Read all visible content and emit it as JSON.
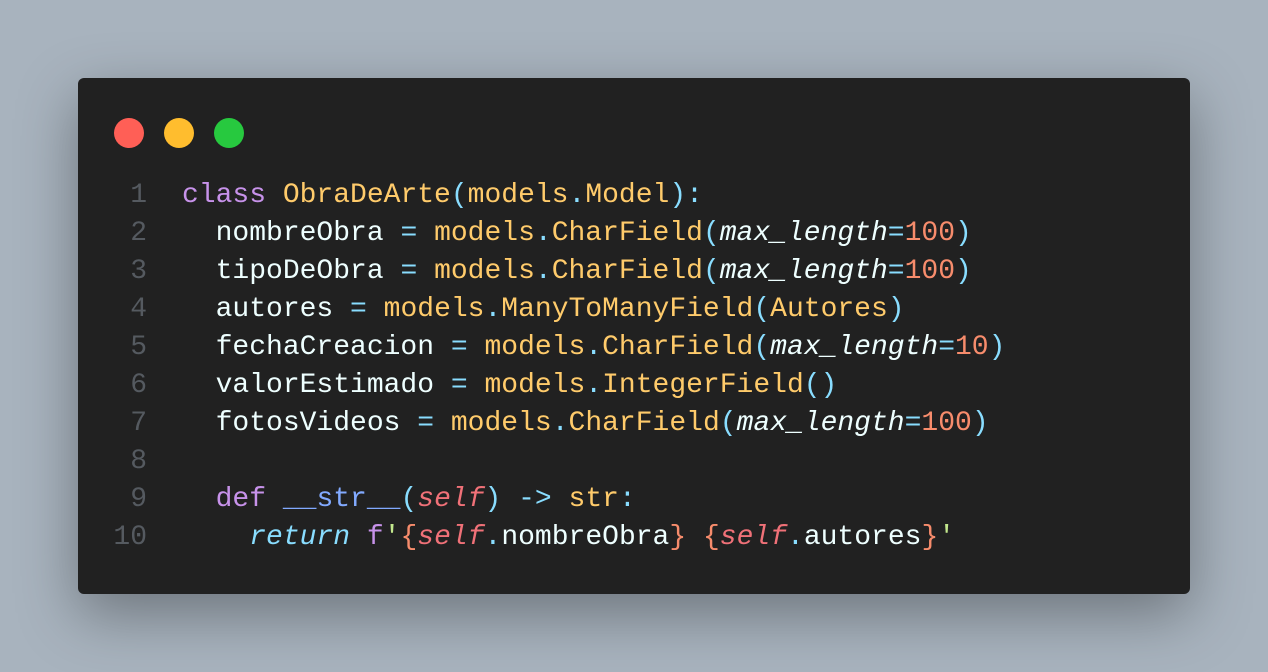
{
  "window": {
    "controls": [
      "close",
      "minimize",
      "maximize"
    ],
    "colors": {
      "background": "#212121",
      "close": "#ff5f56",
      "minimize": "#ffbd2e",
      "maximize": "#27c93f"
    }
  },
  "code": {
    "language": "python",
    "lines": [
      {
        "number": "1",
        "tokens": [
          {
            "t": "class",
            "c": "kw"
          },
          {
            "t": " ",
            "c": ""
          },
          {
            "t": "ObraDeArte",
            "c": "cls"
          },
          {
            "t": "(",
            "c": "punc"
          },
          {
            "t": "models",
            "c": "cls"
          },
          {
            "t": ".",
            "c": "punc"
          },
          {
            "t": "Model",
            "c": "cls"
          },
          {
            "t": "):",
            "c": "punc"
          }
        ]
      },
      {
        "number": "2",
        "tokens": [
          {
            "t": "  nombreObra ",
            "c": ""
          },
          {
            "t": "=",
            "c": "punc"
          },
          {
            "t": " ",
            "c": ""
          },
          {
            "t": "models",
            "c": "cls"
          },
          {
            "t": ".",
            "c": "punc"
          },
          {
            "t": "CharField",
            "c": "cls"
          },
          {
            "t": "(",
            "c": "punc"
          },
          {
            "t": "max_length",
            "c": "param"
          },
          {
            "t": "=",
            "c": "punc"
          },
          {
            "t": "100",
            "c": "num"
          },
          {
            "t": ")",
            "c": "punc"
          }
        ]
      },
      {
        "number": "3",
        "tokens": [
          {
            "t": "  tipoDeObra ",
            "c": ""
          },
          {
            "t": "=",
            "c": "punc"
          },
          {
            "t": " ",
            "c": ""
          },
          {
            "t": "models",
            "c": "cls"
          },
          {
            "t": ".",
            "c": "punc"
          },
          {
            "t": "CharField",
            "c": "cls"
          },
          {
            "t": "(",
            "c": "punc"
          },
          {
            "t": "max_length",
            "c": "param"
          },
          {
            "t": "=",
            "c": "punc"
          },
          {
            "t": "100",
            "c": "num"
          },
          {
            "t": ")",
            "c": "punc"
          }
        ]
      },
      {
        "number": "4",
        "tokens": [
          {
            "t": "  autores ",
            "c": ""
          },
          {
            "t": "=",
            "c": "punc"
          },
          {
            "t": " ",
            "c": ""
          },
          {
            "t": "models",
            "c": "cls"
          },
          {
            "t": ".",
            "c": "punc"
          },
          {
            "t": "ManyToManyField",
            "c": "cls"
          },
          {
            "t": "(",
            "c": "punc"
          },
          {
            "t": "Autores",
            "c": "cls"
          },
          {
            "t": ")",
            "c": "punc"
          }
        ]
      },
      {
        "number": "5",
        "tokens": [
          {
            "t": "  fechaCreacion ",
            "c": ""
          },
          {
            "t": "=",
            "c": "punc"
          },
          {
            "t": " ",
            "c": ""
          },
          {
            "t": "models",
            "c": "cls"
          },
          {
            "t": ".",
            "c": "punc"
          },
          {
            "t": "CharField",
            "c": "cls"
          },
          {
            "t": "(",
            "c": "punc"
          },
          {
            "t": "max_length",
            "c": "param"
          },
          {
            "t": "=",
            "c": "punc"
          },
          {
            "t": "10",
            "c": "num"
          },
          {
            "t": ")",
            "c": "punc"
          }
        ]
      },
      {
        "number": "6",
        "tokens": [
          {
            "t": "  valorEstimado ",
            "c": ""
          },
          {
            "t": "=",
            "c": "punc"
          },
          {
            "t": " ",
            "c": ""
          },
          {
            "t": "models",
            "c": "cls"
          },
          {
            "t": ".",
            "c": "punc"
          },
          {
            "t": "IntegerField",
            "c": "cls"
          },
          {
            "t": "()",
            "c": "punc"
          }
        ]
      },
      {
        "number": "7",
        "tokens": [
          {
            "t": "  fotosVideos ",
            "c": ""
          },
          {
            "t": "=",
            "c": "punc"
          },
          {
            "t": " ",
            "c": ""
          },
          {
            "t": "models",
            "c": "cls"
          },
          {
            "t": ".",
            "c": "punc"
          },
          {
            "t": "CharField",
            "c": "cls"
          },
          {
            "t": "(",
            "c": "punc"
          },
          {
            "t": "max_length",
            "c": "param"
          },
          {
            "t": "=",
            "c": "punc"
          },
          {
            "t": "100",
            "c": "num"
          },
          {
            "t": ")",
            "c": "punc"
          }
        ]
      },
      {
        "number": "8",
        "tokens": []
      },
      {
        "number": "9",
        "tokens": [
          {
            "t": "  ",
            "c": ""
          },
          {
            "t": "def",
            "c": "kw"
          },
          {
            "t": " ",
            "c": ""
          },
          {
            "t": "__str__",
            "c": "fn"
          },
          {
            "t": "(",
            "c": "punc"
          },
          {
            "t": "self",
            "c": "self"
          },
          {
            "t": ")",
            "c": "punc"
          },
          {
            "t": " ",
            "c": ""
          },
          {
            "t": "->",
            "c": "punc"
          },
          {
            "t": " ",
            "c": ""
          },
          {
            "t": "str",
            "c": "cls"
          },
          {
            "t": ":",
            "c": "punc"
          }
        ]
      },
      {
        "number": "10",
        "tokens": [
          {
            "t": "    ",
            "c": ""
          },
          {
            "t": "return",
            "c": "ret"
          },
          {
            "t": " ",
            "c": ""
          },
          {
            "t": "f",
            "c": "kw"
          },
          {
            "t": "'",
            "c": "str"
          },
          {
            "t": "{",
            "c": "brace"
          },
          {
            "t": "self",
            "c": "self"
          },
          {
            "t": ".",
            "c": "punc"
          },
          {
            "t": "nombreObra",
            "c": ""
          },
          {
            "t": "}",
            "c": "brace"
          },
          {
            "t": " ",
            "c": ""
          },
          {
            "t": "{",
            "c": "brace"
          },
          {
            "t": "self",
            "c": "self"
          },
          {
            "t": ".",
            "c": "punc"
          },
          {
            "t": "autores",
            "c": ""
          },
          {
            "t": "}",
            "c": "brace"
          },
          {
            "t": "'",
            "c": "str"
          }
        ]
      }
    ]
  }
}
